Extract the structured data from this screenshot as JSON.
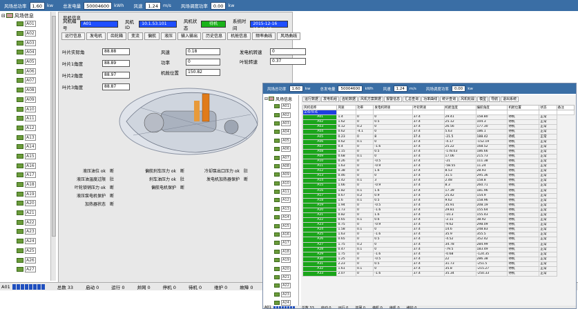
{
  "topbar": {
    "items": [
      {
        "label": "风场总功率",
        "value": "1.60",
        "unit": "kw"
      },
      {
        "label": "总发电量",
        "value": "50004600",
        "unit": "kWh"
      },
      {
        "label": "风速",
        "value": "1.24",
        "unit": "m/s"
      },
      {
        "label": "风场调度功率",
        "value": "0.00",
        "unit": "kw"
      }
    ]
  },
  "tree": {
    "root": "风场信息",
    "nodes": [
      "A01",
      "A02",
      "A03",
      "A04",
      "A05",
      "A06",
      "A07",
      "A08",
      "A09",
      "A10",
      "A11",
      "A12",
      "A13",
      "A14",
      "A15",
      "A16",
      "A17",
      "A18",
      "A19",
      "A20",
      "A21",
      "A22",
      "A23",
      "A24",
      "A25",
      "A26",
      "A27"
    ]
  },
  "main": {
    "title": "风机信息",
    "info": {
      "turbine_no_label": "风机编号",
      "turbine_no": "A01",
      "model_label": "风机ID",
      "model": "10.1.53.101",
      "status_label": "风机状态",
      "status": "待机",
      "time_label": "系统时间",
      "time": "2015-12-16 15:01:06"
    },
    "tabs": [
      "运行信息",
      "发电机",
      "齿轮箱",
      "变流",
      "偏航",
      "液压",
      "输入输出",
      "历史信息",
      "机舱信息",
      "频率曲线",
      "风场曲线"
    ],
    "left_fields": [
      {
        "label": "叶片实际角",
        "value": "88.88"
      },
      {
        "label": "叶片1角度",
        "value": "88.89"
      },
      {
        "label": "叶片2角度",
        "value": "88.97"
      },
      {
        "label": "叶片3角度",
        "value": "88.87"
      }
    ],
    "mid_fields": [
      {
        "label": "风速",
        "value": "0.18"
      },
      {
        "label": "功率",
        "value": "0"
      },
      {
        "label": "机舱位置",
        "value": "150.82"
      }
    ],
    "right_fields": [
      {
        "label": "发电机转速",
        "value": "0"
      },
      {
        "label": "叶轮转速",
        "value": "0.37"
      }
    ],
    "status_items": [
      {
        "label": "液压油位 ok",
        "value": "断"
      },
      {
        "label": "液压油温度过限",
        "value": "肚"
      },
      {
        "label": "叶轮锁销压力 ok",
        "value": "断"
      },
      {
        "label": "液压泵电机保护",
        "value": "断"
      },
      {
        "label": "加热器状态",
        "value": "断"
      },
      {
        "label": "偏航刹车压力 ok",
        "value": "断"
      },
      {
        "label": "刹车油压力 ok",
        "value": "肚"
      },
      {
        "label": "偏航电机保护",
        "value": "断"
      },
      {
        "label": "冷却泵出口压力 ok",
        "value": "肚"
      },
      {
        "label": "发电机加热器保护",
        "value": "断"
      }
    ]
  },
  "bottombar": {
    "prefix": "A01",
    "items": [
      "总数 33",
      "启动 0",
      "运行 0",
      "并网 0",
      "停机 0",
      "待机 0",
      "维护 0",
      "故障 0"
    ]
  },
  "win2": {
    "topbar": {
      "items": [
        {
          "label": "风场总功率",
          "value": "1.60",
          "unit": "kw"
        },
        {
          "label": "总发电量",
          "value": "50004600",
          "unit": "kWh"
        },
        {
          "label": "风速",
          "value": "1.24",
          "unit": "m/s"
        },
        {
          "label": "风场调度功率",
          "value": "0.00",
          "unit": "kw"
        }
      ]
    },
    "tabs": [
      "运行数据",
      "发电机组",
      "齿轮数据",
      "风机方案数据",
      "报警信息",
      "汇总查询",
      "功率曲线",
      "统计查询",
      "风机轮毂",
      "模型",
      "导航",
      "退出系统"
    ],
    "columns": [
      "风机名称",
      "风速",
      "功率",
      "发电机转速",
      "叶轮转速",
      "机舱温度",
      "偏航角度",
      "机舱位置",
      "状态",
      "备注"
    ],
    "first_row": {
      "name": "全选/反选"
    },
    "rows": [
      [
        "A01",
        "1.4",
        "0",
        "0",
        "37.4",
        "29.41",
        "158.80",
        "待机",
        "正常"
      ],
      [
        "A02",
        "1.62",
        "0",
        "0.5",
        "37.4",
        "25.12",
        "104.3",
        "待机",
        "正常"
      ],
      [
        "A03",
        "0.12",
        "0.2",
        "0",
        "37.4",
        "26.56",
        "177.30",
        "待机",
        "正常"
      ],
      [
        "A04",
        "0.62",
        "-4.1",
        "0",
        "37.4",
        "5.63",
        "186.1",
        "待机",
        "正常"
      ],
      [
        "A05",
        "0.23",
        "0",
        "8",
        "37.4",
        "-21.5",
        "188.42",
        "待机",
        "正常"
      ],
      [
        "A06",
        "0.62",
        "0.1",
        "0",
        "37.4",
        "-4.17",
        "-152.19",
        "待机",
        "正常"
      ],
      [
        "A07",
        "0.4",
        "0",
        "-1.6",
        "37.4",
        "25.22",
        "168.52",
        "待机",
        "正常"
      ],
      [
        "A08",
        "1.15",
        "0",
        "0.5",
        "37.4",
        "-178.03",
        "186.66",
        "待机",
        "正常"
      ],
      [
        "A09",
        "0.68",
        "0.1",
        "0",
        "37.4",
        "17.06",
        "215.73",
        "待机",
        "正常"
      ],
      [
        "A10",
        "0.26",
        "0",
        "-0.5",
        "37.4",
        "-21",
        "111.38",
        "待机",
        "正常"
      ],
      [
        "A11",
        "1.63",
        "0",
        "-0.9",
        "37.4",
        "-58.55",
        "11.24",
        "待机",
        "正常"
      ],
      [
        "A12",
        "0.38",
        "0",
        "1.6",
        "37.4",
        "8.53",
        "28.93",
        "待机",
        "正常"
      ],
      [
        "A13",
        "0.46",
        "0",
        "0",
        "37.4",
        "31.5",
        "295.36",
        "待机",
        "正常"
      ],
      [
        "A14",
        "1.42",
        "0.1",
        "3",
        "37.4",
        "2.48",
        "158.8",
        "待机",
        "正常"
      ],
      [
        "A15",
        "1.66",
        "0",
        "-0.9",
        "37.4",
        "8.3",
        "260.71",
        "待机",
        "正常"
      ],
      [
        "A16",
        "1.82",
        "0.1",
        "1.6",
        "37.4",
        "17.39",
        "181.96",
        "待机",
        "正常"
      ],
      [
        "A17",
        "0.67",
        "0.2",
        "0.9",
        "37.4",
        "25.42",
        "154.9",
        "待机",
        "正常"
      ],
      [
        "A18",
        "1.6",
        "0.1",
        "0.5",
        "37.4",
        "9.62",
        "158.96",
        "待机",
        "正常"
      ],
      [
        "A19",
        "1.94",
        "0",
        "-0.5",
        "37.4",
        "35.91",
        "208.19",
        "待机",
        "正常"
      ],
      [
        "A20",
        "1.73",
        "0",
        "-1.6",
        "37.4",
        "29.81",
        "155.64",
        "待机",
        "正常"
      ],
      [
        "A21",
        "0.82",
        "0",
        "1.6",
        "37.4",
        "-10.3",
        "155.43",
        "待机",
        "正常"
      ],
      [
        "A22",
        "0.65",
        "0.1",
        "0.6",
        "37.4",
        "-2.11",
        "38.92",
        "待机",
        "正常"
      ],
      [
        "A23",
        "0.75",
        "0",
        "-0.9",
        "37.4",
        "-9.62",
        "298.09",
        "待机",
        "正常"
      ],
      [
        "A24",
        "1.58",
        "0.1",
        "0",
        "37.4",
        "14.6",
        "248.83",
        "待机",
        "正常"
      ],
      [
        "A25",
        "1.63",
        "0",
        "-1.6",
        "37.4",
        "35.9",
        "355.5",
        "待机",
        "正常"
      ],
      [
        "A26",
        "0.65",
        "0",
        "0.5",
        "37.4",
        "-4.52",
        "352.42",
        "待机",
        "正常"
      ],
      [
        "A27",
        "1.75",
        "0.2",
        "0",
        "37.4",
        "34.78",
        "284.99",
        "待机",
        "正常"
      ],
      [
        "A28",
        "0.47",
        "0.1",
        "0",
        "37.4",
        "-79.5",
        "183.49",
        "待机",
        "正常"
      ],
      [
        "A29",
        "1.75",
        "0",
        "-1.6",
        "37.4",
        "-0.68",
        "-124.35",
        "待机",
        "正常"
      ],
      [
        "A30",
        "1.25",
        "0",
        "-0.5",
        "37.4",
        "22",
        "286.38",
        "待机",
        "正常"
      ],
      [
        "A31",
        "2.23",
        "0",
        "0.5",
        "37.4",
        "31.73",
        "-251.5",
        "待机",
        "正常"
      ],
      [
        "A32",
        "1.61",
        "0.1",
        "0",
        "37.4",
        "35.8",
        "-215.27",
        "待机",
        "正常"
      ],
      [
        "A33",
        "2.07",
        "0",
        "-1.6",
        "37.4",
        "35.34",
        "-250.33",
        "待机",
        "正常"
      ]
    ],
    "bottom": [
      "总数 33",
      "启动 0",
      "运行 0",
      "并网 0",
      "停机 0",
      "待机 0",
      "维护 0"
    ]
  },
  "colors": {
    "topbar": "#3a6ea5",
    "status_green": "#1ab31a",
    "highlight_blue": "#1f4fff",
    "tree_icon": "#6b9b3a"
  }
}
